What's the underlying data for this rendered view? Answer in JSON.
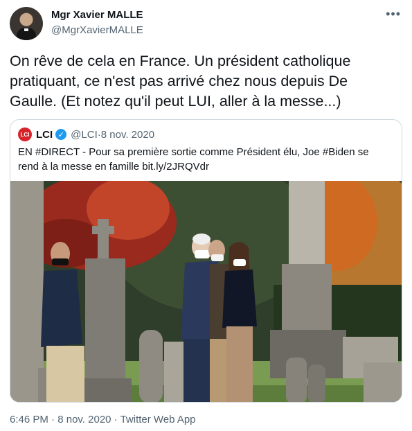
{
  "author": {
    "name": "Mgr Xavier MALLE",
    "handle": "@MgrXavierMALLE"
  },
  "tweet": {
    "text": "On rêve de cela en France. Un président catholique pratiquant, ce n'est pas arrivé chez nous depuis De Gaulle. (Et notez qu'il peut LUI, aller à la messe...)"
  },
  "quote": {
    "logo_text": "LCI",
    "name": "LCI",
    "handle": "@LCI",
    "separator": " · ",
    "date": "8 nov. 2020",
    "text": "EN #DIRECT - Pour sa première sortie comme Président élu, Joe #Biden se rend à la messe en famille bit.ly/2JRQVdr"
  },
  "footer": {
    "time": "6:46 PM",
    "separator": " · ",
    "date": "8 nov. 2020",
    "separator2": " · ",
    "source": "Twitter Web App"
  },
  "icons": {
    "more": "more-icon",
    "verified": "verified-icon"
  },
  "colors": {
    "verified": "#1d9bf0",
    "lci": "#d8232a",
    "muted": "#536471"
  }
}
